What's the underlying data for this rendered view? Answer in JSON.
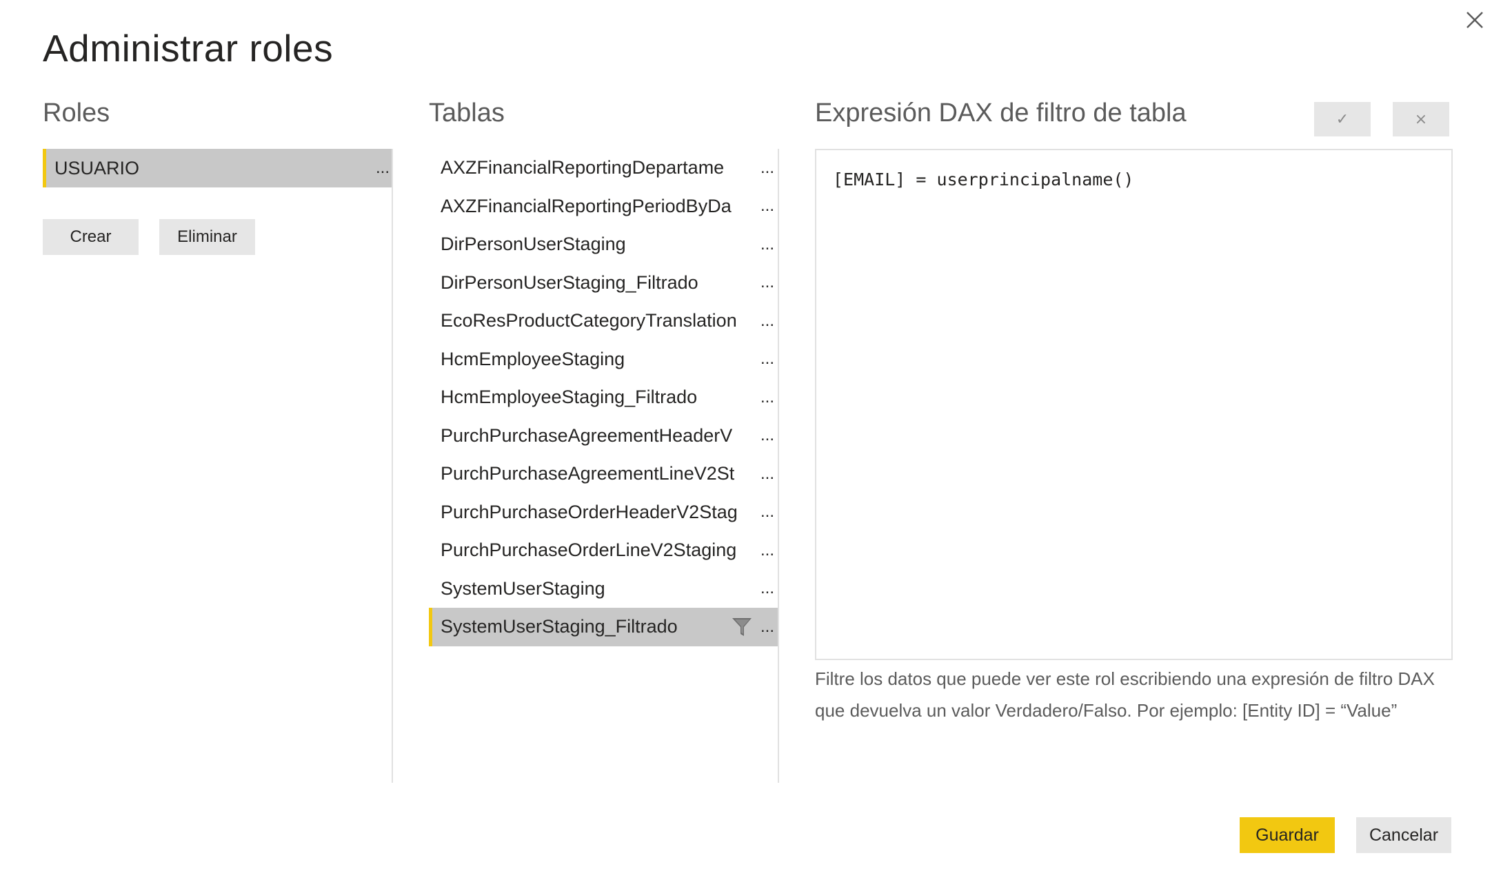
{
  "dialog": {
    "title": "Administrar roles"
  },
  "roles": {
    "heading": "Roles",
    "items": [
      {
        "label": "USUARIO",
        "menu": "...",
        "selected": true
      }
    ],
    "create_label": "Crear",
    "delete_label": "Eliminar"
  },
  "tables": {
    "heading": "Tablas",
    "items": [
      {
        "name": "AXZFinancialReportingDepartame",
        "menu": "..."
      },
      {
        "name": "AXZFinancialReportingPeriodByDa",
        "menu": "..."
      },
      {
        "name": "DirPersonUserStaging",
        "menu": "..."
      },
      {
        "name": "DirPersonUserStaging_Filtrado",
        "menu": "..."
      },
      {
        "name": "EcoResProductCategoryTranslation",
        "menu": "..."
      },
      {
        "name": "HcmEmployeeStaging",
        "menu": "..."
      },
      {
        "name": "HcmEmployeeStaging_Filtrado",
        "menu": "..."
      },
      {
        "name": "PurchPurchaseAgreementHeaderV",
        "menu": "..."
      },
      {
        "name": "PurchPurchaseAgreementLineV2St",
        "menu": "..."
      },
      {
        "name": "PurchPurchaseOrderHeaderV2Stag",
        "menu": "..."
      },
      {
        "name": "PurchPurchaseOrderLineV2Staging",
        "menu": "..."
      },
      {
        "name": "SystemUserStaging",
        "menu": "..."
      },
      {
        "name": "SystemUserStaging_Filtrado",
        "menu": "...",
        "selected": true,
        "has_filter": true
      }
    ]
  },
  "dax": {
    "heading": "Expresión DAX de filtro de tabla",
    "confirm_glyph": "✓",
    "cancel_glyph": "×",
    "expression": "[EMAIL] = userprincipalname()",
    "help": "Filtre los datos que puede ver este rol escribiendo una expresión de filtro DAX que devuelva un valor Verdadero/Falso. Por ejemplo: [Entity ID] = “Value”"
  },
  "footer": {
    "save_label": "Guardar",
    "cancel_label": "Cancelar"
  },
  "icons": {
    "close": "close-icon",
    "filter": "filter-icon"
  },
  "colors": {
    "accent": "#f2c811",
    "selected_bg": "#c8c8c8",
    "button_bg": "#e6e6e6"
  }
}
